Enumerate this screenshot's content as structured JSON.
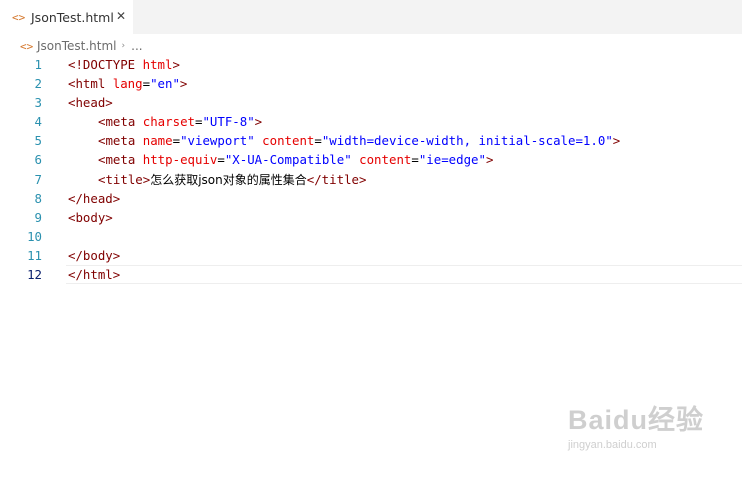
{
  "tab": {
    "label": "JsonTest.html",
    "icon": "html-file-icon",
    "close_symbol": "✕"
  },
  "breadcrumb": {
    "file": "JsonTest.html",
    "separator": "›",
    "more": "..."
  },
  "editor": {
    "lines": [
      {
        "n": "1",
        "tokens": [
          [
            "tag",
            "<!DOCTYPE "
          ],
          [
            "attr",
            "html"
          ],
          [
            "tag",
            ">"
          ]
        ]
      },
      {
        "n": "2",
        "tokens": [
          [
            "tag",
            "<html "
          ],
          [
            "attr",
            "lang"
          ],
          [
            "txt",
            "="
          ],
          [
            "str",
            "\"en\""
          ],
          [
            "tag",
            ">"
          ]
        ]
      },
      {
        "n": "3",
        "tokens": [
          [
            "tag",
            "<head>"
          ]
        ]
      },
      {
        "n": "4",
        "indent": 1,
        "tokens": [
          [
            "tag",
            "<meta "
          ],
          [
            "attr",
            "charset"
          ],
          [
            "txt",
            "="
          ],
          [
            "str",
            "\"UTF-8\""
          ],
          [
            "tag",
            ">"
          ]
        ]
      },
      {
        "n": "5",
        "indent": 1,
        "tokens": [
          [
            "tag",
            "<meta "
          ],
          [
            "attr",
            "name"
          ],
          [
            "txt",
            "="
          ],
          [
            "str",
            "\"viewport\""
          ],
          [
            "txt",
            " "
          ],
          [
            "attr",
            "content"
          ],
          [
            "txt",
            "="
          ],
          [
            "str",
            "\"width=device-width, initial-scale=1.0\""
          ],
          [
            "tag",
            ">"
          ]
        ]
      },
      {
        "n": "6",
        "indent": 1,
        "tokens": [
          [
            "tag",
            "<meta "
          ],
          [
            "attr",
            "http-equiv"
          ],
          [
            "txt",
            "="
          ],
          [
            "str",
            "\"X-UA-Compatible\""
          ],
          [
            "txt",
            " "
          ],
          [
            "attr",
            "content"
          ],
          [
            "txt",
            "="
          ],
          [
            "str",
            "\"ie=edge\""
          ],
          [
            "tag",
            ">"
          ]
        ]
      },
      {
        "n": "7",
        "indent": 1,
        "tokens": [
          [
            "tag",
            "<title>"
          ],
          [
            "cn",
            "怎么获取json对象的属性集合"
          ],
          [
            "tag",
            "</title>"
          ]
        ]
      },
      {
        "n": "8",
        "tokens": [
          [
            "tag",
            "</head>"
          ]
        ]
      },
      {
        "n": "9",
        "tokens": [
          [
            "tag",
            "<body>"
          ]
        ]
      },
      {
        "n": "10",
        "tokens": []
      },
      {
        "n": "11",
        "tokens": [
          [
            "tag",
            "</body>"
          ]
        ]
      },
      {
        "n": "12",
        "current": true,
        "tokens": [
          [
            "tag",
            "</html>"
          ]
        ]
      }
    ]
  },
  "watermark": {
    "logo": "Baidu经验",
    "url": "jingyan.baidu.com"
  },
  "colors": {
    "tag": "#800000",
    "attribute": "#e50000",
    "string": "#0000ff",
    "line_number": "#2b91af",
    "file_icon": "#d4762a"
  }
}
